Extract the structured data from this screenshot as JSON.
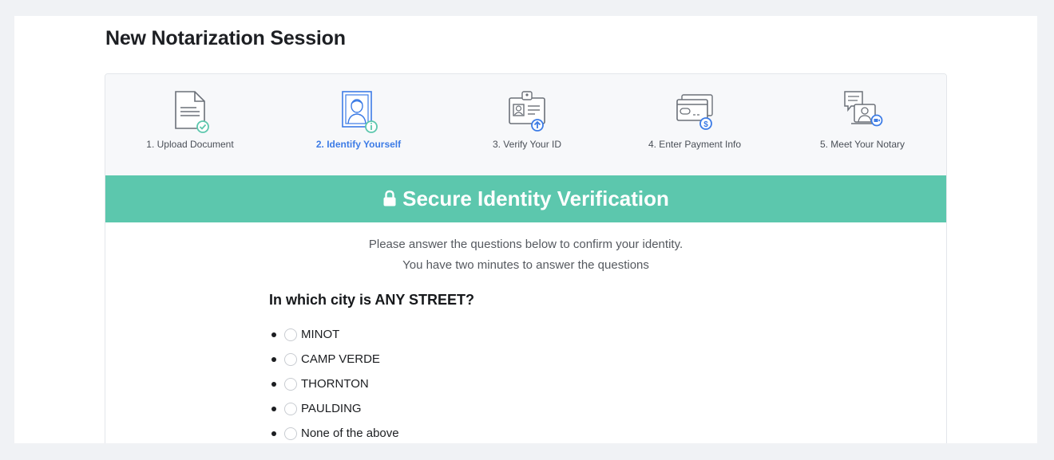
{
  "page_title": "New Notarization Session",
  "steps": [
    {
      "label": "1. Upload Document",
      "icon": "document-check-icon",
      "state": "completed"
    },
    {
      "label": "2. Identify Yourself",
      "icon": "person-portrait-icon",
      "state": "active"
    },
    {
      "label": "3. Verify Your ID",
      "icon": "id-card-upload-icon",
      "state": "pending"
    },
    {
      "label": "4. Enter Payment Info",
      "icon": "credit-card-icon",
      "state": "pending"
    },
    {
      "label": "5. Meet Your Notary",
      "icon": "video-call-icon",
      "state": "pending"
    }
  ],
  "banner": {
    "title": "Secure Identity Verification",
    "icon": "lock-icon",
    "color": "#5cc7ad"
  },
  "intro": {
    "line1": "Please answer the questions below to confirm your identity.",
    "line2": "You have two minutes to answer the questions"
  },
  "question": {
    "text": "In which city is ANY STREET?",
    "options": [
      "MINOT",
      "CAMP VERDE",
      "THORNTON",
      "PAULDING",
      "None of the above"
    ]
  },
  "colors": {
    "accent": "#3d7ce6",
    "success": "#5cc7ad"
  }
}
